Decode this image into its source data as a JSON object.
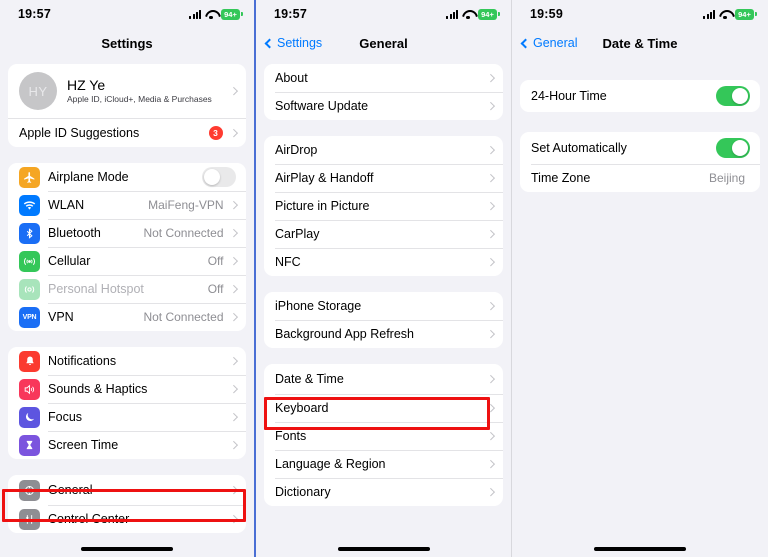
{
  "panels": [
    {
      "id": "settings",
      "status": {
        "time": "19:57",
        "battery": "94+",
        "signal_icon": "cellular-signal-icon",
        "wifi_icon": "wifi-icon",
        "battery_icon": "battery-icon"
      },
      "nav": {
        "title": "Settings",
        "back": null
      },
      "account": {
        "avatar_initials": "HY",
        "name": "HZ Ye",
        "subtitle": "Apple ID, iCloud+, Media & Purchases",
        "suggestions_label": "Apple ID Suggestions",
        "suggestions_badge": "3"
      },
      "groups": [
        {
          "rows": [
            {
              "label": "Airplane Mode",
              "icon": "airplane-icon",
              "icon_color": "#f5a623",
              "control": "toggle",
              "toggle_on": false
            },
            {
              "label": "WLAN",
              "icon": "wifi-icon",
              "icon_color": "#007aff",
              "value": "MaiFeng-VPN",
              "chevron": true
            },
            {
              "label": "Bluetooth",
              "icon": "bluetooth-icon",
              "icon_color": "#1a6ef5",
              "value": "Not Connected",
              "chevron": true
            },
            {
              "label": "Cellular",
              "icon": "cellular-icon",
              "icon_color": "#34c759",
              "value": "Off",
              "chevron": true
            },
            {
              "label": "Personal Hotspot",
              "icon": "hotspot-icon",
              "icon_color": "#a8e4bb",
              "value": "Off",
              "chevron": true,
              "dim": true
            },
            {
              "label": "VPN",
              "icon": "vpn-icon",
              "icon_color": "#1a6ef5",
              "value": "Not Connected",
              "chevron": true
            }
          ]
        },
        {
          "rows": [
            {
              "label": "Notifications",
              "icon": "notifications-bell-icon",
              "icon_color": "#fb3b30",
              "chevron": true
            },
            {
              "label": "Sounds & Haptics",
              "icon": "sounds-speaker-icon",
              "icon_color": "#f8375b",
              "chevron": true
            },
            {
              "label": "Focus",
              "icon": "focus-moon-icon",
              "icon_color": "#5d55e0",
              "chevron": true
            },
            {
              "label": "Screen Time",
              "icon": "screen-time-hourglass-icon",
              "icon_color": "#7b54de",
              "chevron": true
            }
          ]
        },
        {
          "rows": [
            {
              "label": "General",
              "icon": "gear-icon",
              "icon_color": "#8e8e93",
              "chevron": true,
              "highlighted": true
            },
            {
              "label": "Control Center",
              "icon": "control-center-icon",
              "icon_color": "#8e8e93",
              "chevron": true
            }
          ]
        }
      ]
    },
    {
      "id": "general",
      "status": {
        "time": "19:57",
        "battery": "94+"
      },
      "nav": {
        "title": "General",
        "back": "Settings"
      },
      "groups": [
        {
          "rows": [
            {
              "label": "About",
              "chevron": true
            },
            {
              "label": "Software Update",
              "chevron": true
            }
          ]
        },
        {
          "rows": [
            {
              "label": "AirDrop",
              "chevron": true
            },
            {
              "label": "AirPlay & Handoff",
              "chevron": true
            },
            {
              "label": "Picture in Picture",
              "chevron": true
            },
            {
              "label": "CarPlay",
              "chevron": true
            },
            {
              "label": "NFC",
              "chevron": true
            }
          ]
        },
        {
          "rows": [
            {
              "label": "iPhone Storage",
              "chevron": true
            },
            {
              "label": "Background App Refresh",
              "chevron": true
            }
          ]
        },
        {
          "rows": [
            {
              "label": "Date & Time",
              "chevron": true,
              "highlighted": true
            },
            {
              "label": "Keyboard",
              "chevron": true
            },
            {
              "label": "Fonts",
              "chevron": true
            },
            {
              "label": "Language & Region",
              "chevron": true
            },
            {
              "label": "Dictionary",
              "chevron": true
            }
          ]
        }
      ]
    },
    {
      "id": "datetime",
      "status": {
        "time": "19:59",
        "battery": "94+"
      },
      "nav": {
        "title": "Date & Time",
        "back": "General"
      },
      "groups": [
        {
          "rows": [
            {
              "label": "24-Hour Time",
              "control": "toggle",
              "toggle_on": true
            }
          ]
        },
        {
          "rows": [
            {
              "label": "Set Automatically",
              "control": "toggle",
              "toggle_on": true
            },
            {
              "label": "Time Zone",
              "value": "Beijing"
            }
          ]
        }
      ]
    }
  ],
  "colors": {
    "accent_blue": "#007aff",
    "toggle_on": "#34c759",
    "badge_red": "#ff3b30",
    "highlight_red": "#ee1111",
    "background": "#f2f2f7",
    "card": "#ffffff"
  }
}
